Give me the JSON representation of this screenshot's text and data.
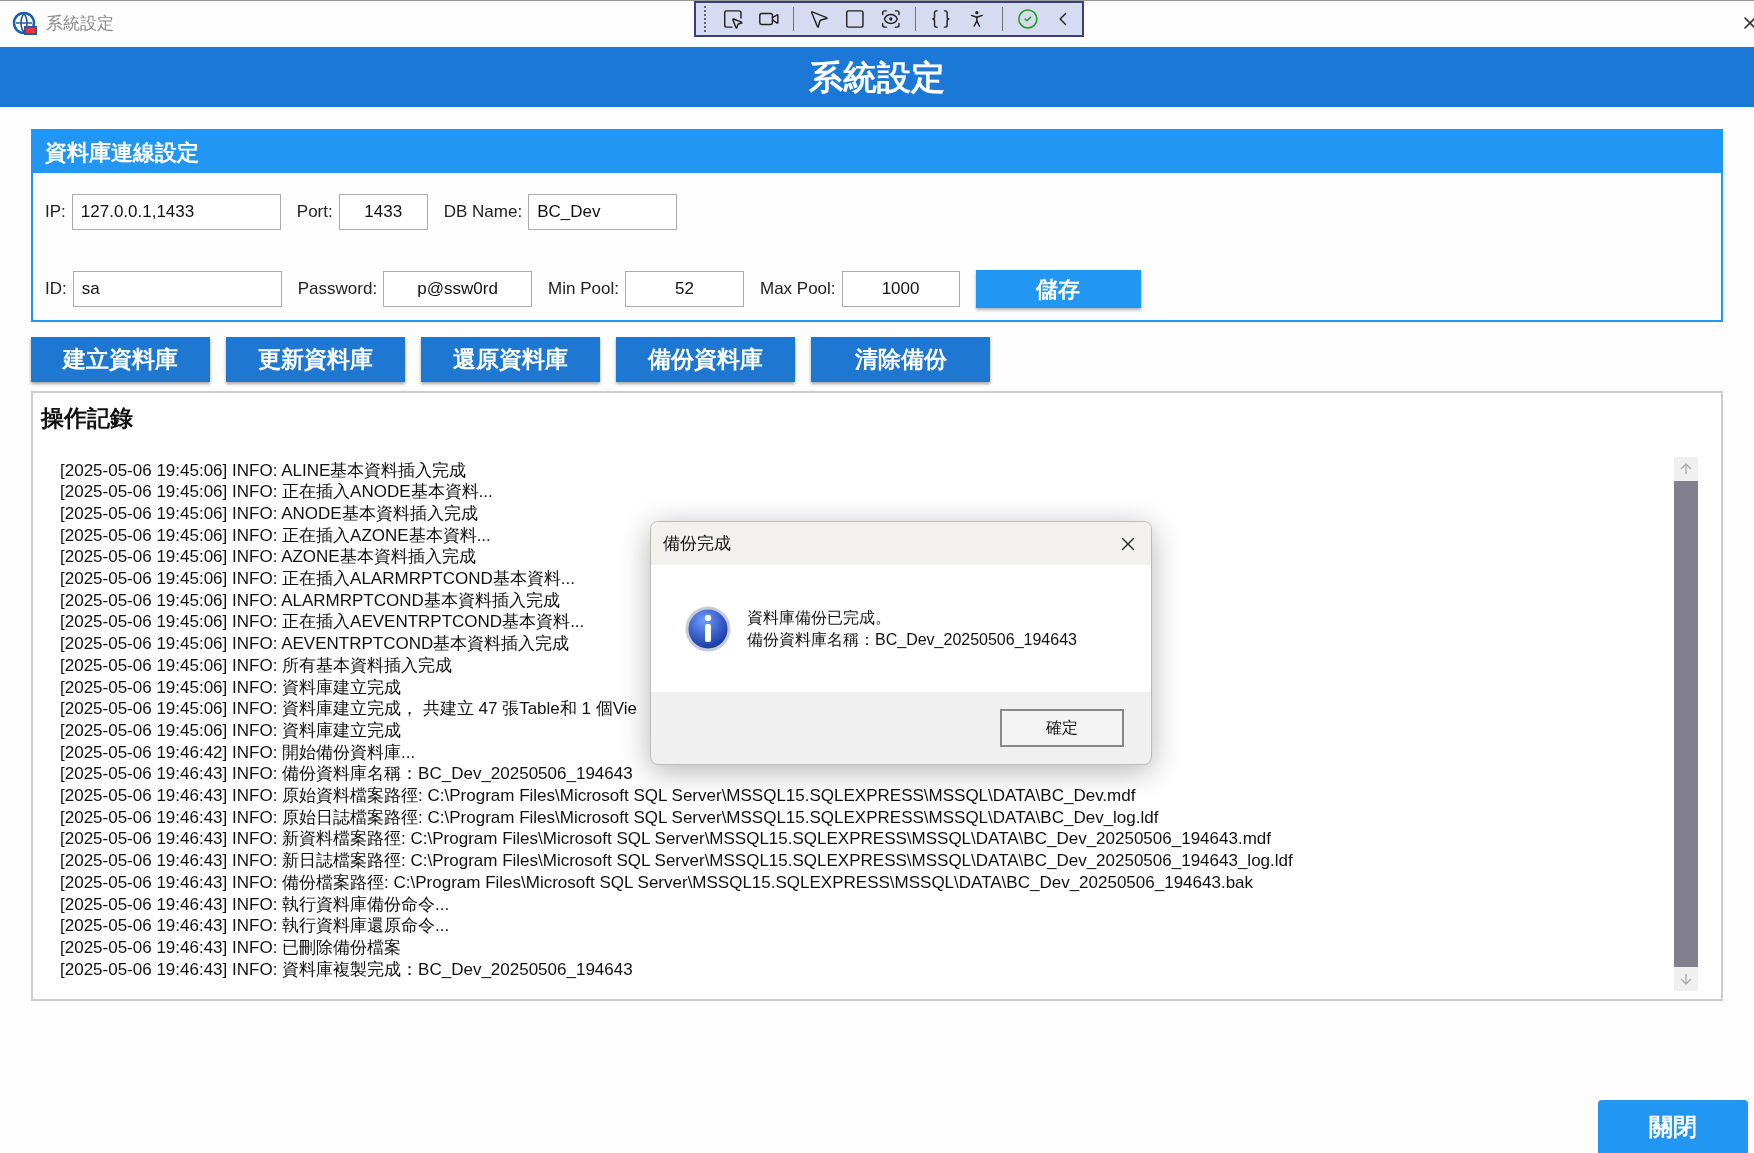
{
  "window": {
    "title": "系統設定"
  },
  "header": {
    "title": "系統設定"
  },
  "connection": {
    "title": "資料庫連線設定",
    "rows": [
      [
        {
          "label": "IP:",
          "value": "127.0.0.1,1433"
        },
        {
          "label": "Port:",
          "value": "1433"
        },
        {
          "label": "DB Name:",
          "value": "BC_Dev"
        }
      ],
      [
        {
          "label": "ID:",
          "value": "sa"
        },
        {
          "label": "Password:",
          "value": "p@ssw0rd"
        },
        {
          "label": "Min Pool:",
          "value": "52"
        },
        {
          "label": "Max Pool:",
          "value": "1000"
        }
      ]
    ],
    "save_button": "儲存"
  },
  "actions": [
    "建立資料庫",
    "更新資料庫",
    "還原資料庫",
    "備份資料庫",
    "清除備份"
  ],
  "log": {
    "title": "操作記錄",
    "lines": [
      "[2025-05-06 19:45:06] INFO: ALINE基本資料插入完成",
      "[2025-05-06 19:45:06] INFO: 正在插入ANODE基本資料...",
      "[2025-05-06 19:45:06] INFO: ANODE基本資料插入完成",
      "[2025-05-06 19:45:06] INFO: 正在插入AZONE基本資料...",
      "[2025-05-06 19:45:06] INFO: AZONE基本資料插入完成",
      "[2025-05-06 19:45:06] INFO: 正在插入ALARMRPTCOND基本資料...",
      "[2025-05-06 19:45:06] INFO: ALARMRPTCOND基本資料插入完成",
      "[2025-05-06 19:45:06] INFO: 正在插入AEVENTRPTCOND基本資料...",
      "[2025-05-06 19:45:06] INFO: AEVENTRPTCOND基本資料插入完成",
      "[2025-05-06 19:45:06] INFO: 所有基本資料插入完成",
      "[2025-05-06 19:45:06] INFO: 資料庫建立完成",
      "[2025-05-06 19:45:06] INFO: 資料庫建立完成， 共建立 47 張Table和 1 個Vie",
      "[2025-05-06 19:45:06] INFO: 資料庫建立完成",
      "[2025-05-06 19:46:42] INFO: 開始備份資料庫...",
      "[2025-05-06 19:46:43] INFO: 備份資料庫名稱：BC_Dev_20250506_194643",
      "[2025-05-06 19:46:43] INFO: 原始資料檔案路徑: C:\\Program Files\\Microsoft SQL Server\\MSSQL15.SQLEXPRESS\\MSSQL\\DATA\\BC_Dev.mdf",
      "[2025-05-06 19:46:43] INFO: 原始日誌檔案路徑: C:\\Program Files\\Microsoft SQL Server\\MSSQL15.SQLEXPRESS\\MSSQL\\DATA\\BC_Dev_log.ldf",
      "[2025-05-06 19:46:43] INFO: 新資料檔案路徑: C:\\Program Files\\Microsoft SQL Server\\MSSQL15.SQLEXPRESS\\MSSQL\\DATA\\BC_Dev_20250506_194643.mdf",
      "[2025-05-06 19:46:43] INFO: 新日誌檔案路徑: C:\\Program Files\\Microsoft SQL Server\\MSSQL15.SQLEXPRESS\\MSSQL\\DATA\\BC_Dev_20250506_194643_log.ldf",
      "[2025-05-06 19:46:43] INFO: 備份檔案路徑: C:\\Program Files\\Microsoft SQL Server\\MSSQL15.SQLEXPRESS\\MSSQL\\DATA\\BC_Dev_20250506_194643.bak",
      "[2025-05-06 19:46:43] INFO: 執行資料庫備份命令...",
      "[2025-05-06 19:46:43] INFO: 執行資料庫還原命令...",
      "[2025-05-06 19:46:43] INFO: 已刪除備份檔案",
      "[2025-05-06 19:46:43] INFO: 資料庫複製完成：BC_Dev_20250506_194643"
    ]
  },
  "dialog": {
    "title": "備份完成",
    "message": [
      "資料庫備份已完成。",
      "備份資料庫名稱：BC_Dev_20250506_194643"
    ],
    "ok_button": "確定"
  },
  "close_button": "關閉"
}
